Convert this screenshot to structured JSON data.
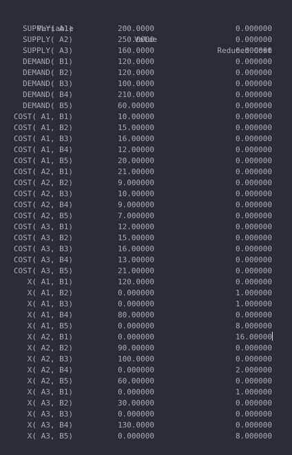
{
  "header": {
    "variable": "Variable",
    "value": "Value",
    "reduced_cost": "Reduced Cost"
  },
  "rows": [
    {
      "variable": "SUPPLY( A1)",
      "value": "200.0000",
      "reduced_cost": "0.000000"
    },
    {
      "variable": "SUPPLY( A2)",
      "value": "250.0000",
      "reduced_cost": "0.000000"
    },
    {
      "variable": "SUPPLY( A3)",
      "value": "160.0000",
      "reduced_cost": "0.000000"
    },
    {
      "variable": "DEMAND( B1)",
      "value": "120.0000",
      "reduced_cost": "0.000000"
    },
    {
      "variable": "DEMAND( B2)",
      "value": "120.0000",
      "reduced_cost": "0.000000"
    },
    {
      "variable": "DEMAND( B3)",
      "value": "100.0000",
      "reduced_cost": "0.000000"
    },
    {
      "variable": "DEMAND( B4)",
      "value": "210.0000",
      "reduced_cost": "0.000000"
    },
    {
      "variable": "DEMAND( B5)",
      "value": "60.00000",
      "reduced_cost": "0.000000"
    },
    {
      "variable": "COST( A1, B1)",
      "value": "10.00000",
      "reduced_cost": "0.000000"
    },
    {
      "variable": "COST( A1, B2)",
      "value": "15.00000",
      "reduced_cost": "0.000000"
    },
    {
      "variable": "COST( A1, B3)",
      "value": "16.00000",
      "reduced_cost": "0.000000"
    },
    {
      "variable": "COST( A1, B4)",
      "value": "12.00000",
      "reduced_cost": "0.000000"
    },
    {
      "variable": "COST( A1, B5)",
      "value": "20.00000",
      "reduced_cost": "0.000000"
    },
    {
      "variable": "COST( A2, B1)",
      "value": "21.00000",
      "reduced_cost": "0.000000"
    },
    {
      "variable": "COST( A2, B2)",
      "value": "9.000000",
      "reduced_cost": "0.000000"
    },
    {
      "variable": "COST( A2, B3)",
      "value": "10.00000",
      "reduced_cost": "0.000000"
    },
    {
      "variable": "COST( A2, B4)",
      "value": "9.000000",
      "reduced_cost": "0.000000"
    },
    {
      "variable": "COST( A2, B5)",
      "value": "7.000000",
      "reduced_cost": "0.000000"
    },
    {
      "variable": "COST( A3, B1)",
      "value": "12.00000",
      "reduced_cost": "0.000000"
    },
    {
      "variable": "COST( A3, B2)",
      "value": "15.00000",
      "reduced_cost": "0.000000"
    },
    {
      "variable": "COST( A3, B3)",
      "value": "16.00000",
      "reduced_cost": "0.000000"
    },
    {
      "variable": "COST( A3, B4)",
      "value": "13.00000",
      "reduced_cost": "0.000000"
    },
    {
      "variable": "COST( A3, B5)",
      "value": "21.00000",
      "reduced_cost": "0.000000"
    },
    {
      "variable": "X( A1, B1)",
      "value": "120.0000",
      "reduced_cost": "0.000000"
    },
    {
      "variable": "X( A1, B2)",
      "value": "0.000000",
      "reduced_cost": "1.000000"
    },
    {
      "variable": "X( A1, B3)",
      "value": "0.000000",
      "reduced_cost": "1.000000"
    },
    {
      "variable": "X( A1, B4)",
      "value": "80.00000",
      "reduced_cost": "0.000000"
    },
    {
      "variable": "X( A1, B5)",
      "value": "0.000000",
      "reduced_cost": "8.000000"
    },
    {
      "variable": "X( A2, B1)",
      "value": "0.000000",
      "reduced_cost": "16.00000"
    },
    {
      "variable": "X( A2, B2)",
      "value": "90.00000",
      "reduced_cost": "0.000000"
    },
    {
      "variable": "X( A2, B3)",
      "value": "100.0000",
      "reduced_cost": "0.000000"
    },
    {
      "variable": "X( A2, B4)",
      "value": "0.000000",
      "reduced_cost": "2.000000"
    },
    {
      "variable": "X( A2, B5)",
      "value": "60.00000",
      "reduced_cost": "0.000000"
    },
    {
      "variable": "X( A3, B1)",
      "value": "0.000000",
      "reduced_cost": "1.000000"
    },
    {
      "variable": "X( A3, B2)",
      "value": "30.00000",
      "reduced_cost": "0.000000"
    },
    {
      "variable": "X( A3, B3)",
      "value": "0.000000",
      "reduced_cost": "0.000000"
    },
    {
      "variable": "X( A3, B4)",
      "value": "130.0000",
      "reduced_cost": "0.000000"
    },
    {
      "variable": "X( A3, B5)",
      "value": "0.000000",
      "reduced_cost": "8.000000"
    }
  ]
}
